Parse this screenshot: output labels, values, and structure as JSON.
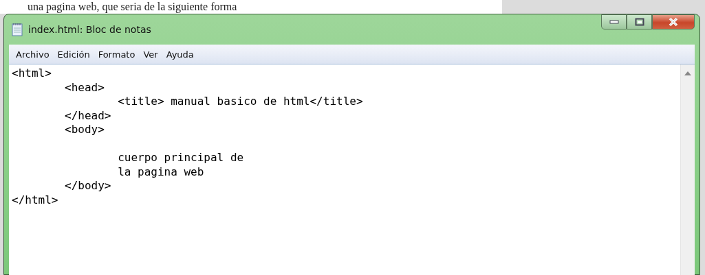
{
  "background_text": "una pagina web, que seria de la siguiente forma",
  "window": {
    "title": "index.html: Bloc de notas"
  },
  "menu": [
    {
      "label": "Archivo"
    },
    {
      "label": "Edición"
    },
    {
      "label": "Formato"
    },
    {
      "label": "Ver"
    },
    {
      "label": "Ayuda"
    }
  ],
  "editor": {
    "text": "<html>\n\t<head>\n\t\t<title> manual basico de html</title>\n\t</head>\n\t<body>\n\n\t\tcuerpo principal de\n\t\tla pagina web\n\t</body>\n</html>"
  }
}
